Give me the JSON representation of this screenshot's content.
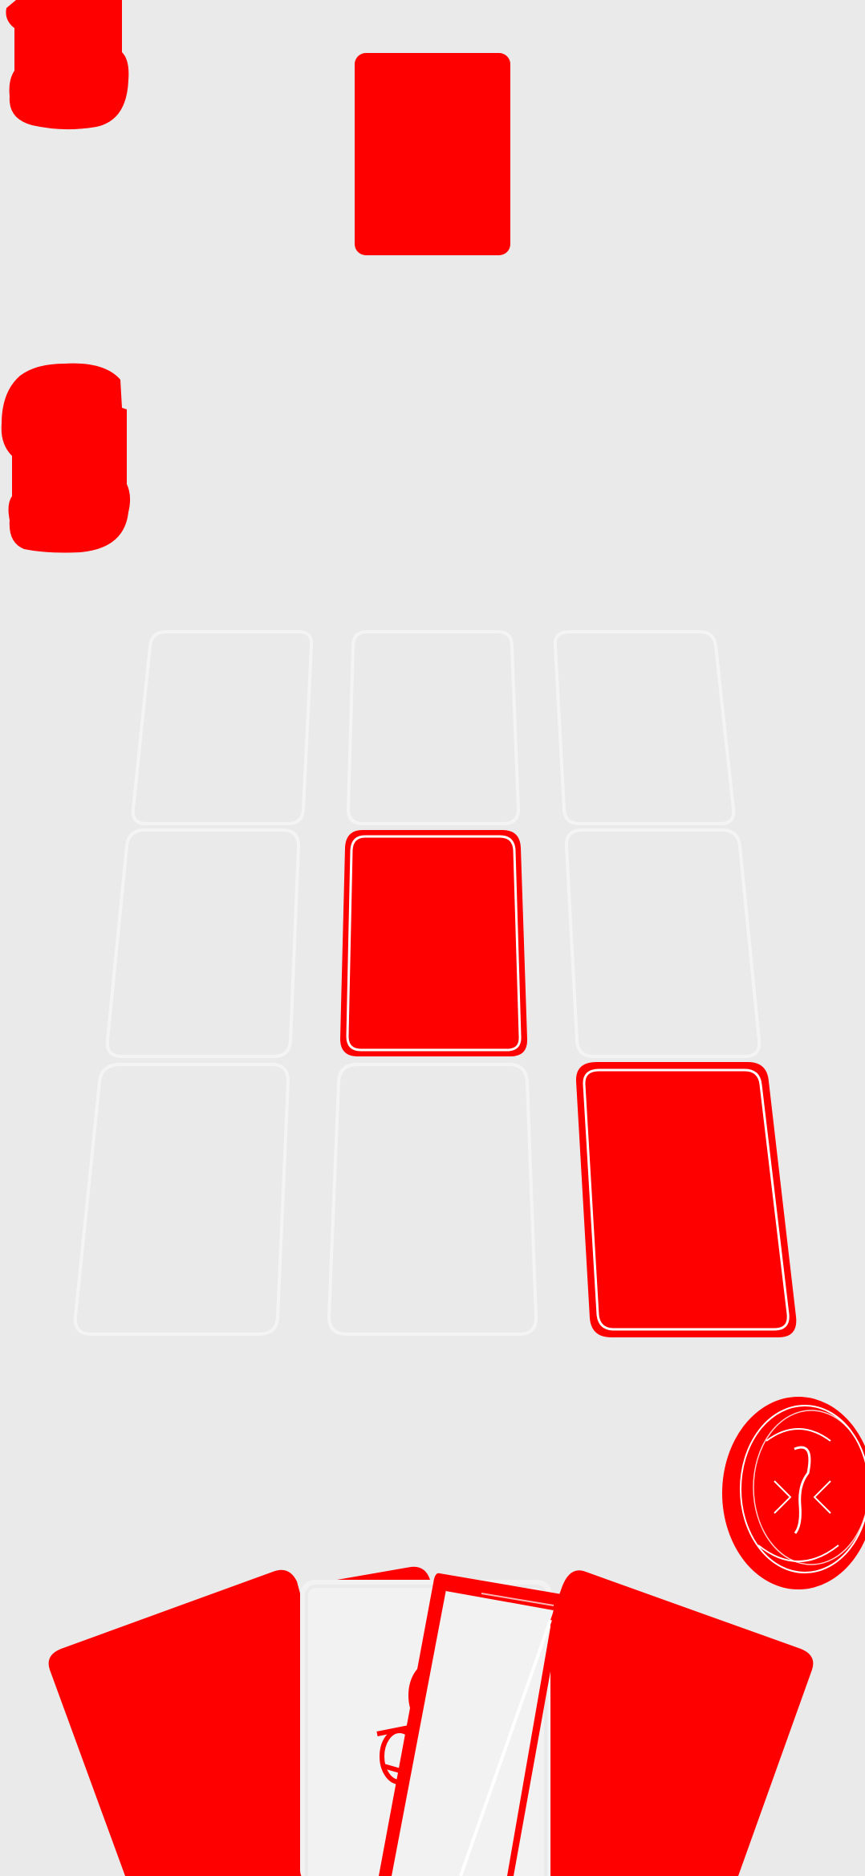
{
  "colors": {
    "background": "#eaeaea",
    "accent": "#ff0000",
    "slot_outline": "#f4f4f4",
    "face_card": "#f2f2f2"
  },
  "board": {
    "rows": 3,
    "columns": 3,
    "filled_slots": [
      "row-2-col-2",
      "row-3-col-3"
    ]
  },
  "hand": {
    "card_count": 5,
    "face_up_card_index": 2
  },
  "icons": {
    "score_top": "blob-icon",
    "score_mid": "blob-icon",
    "deck": "deck-dial-icon"
  }
}
